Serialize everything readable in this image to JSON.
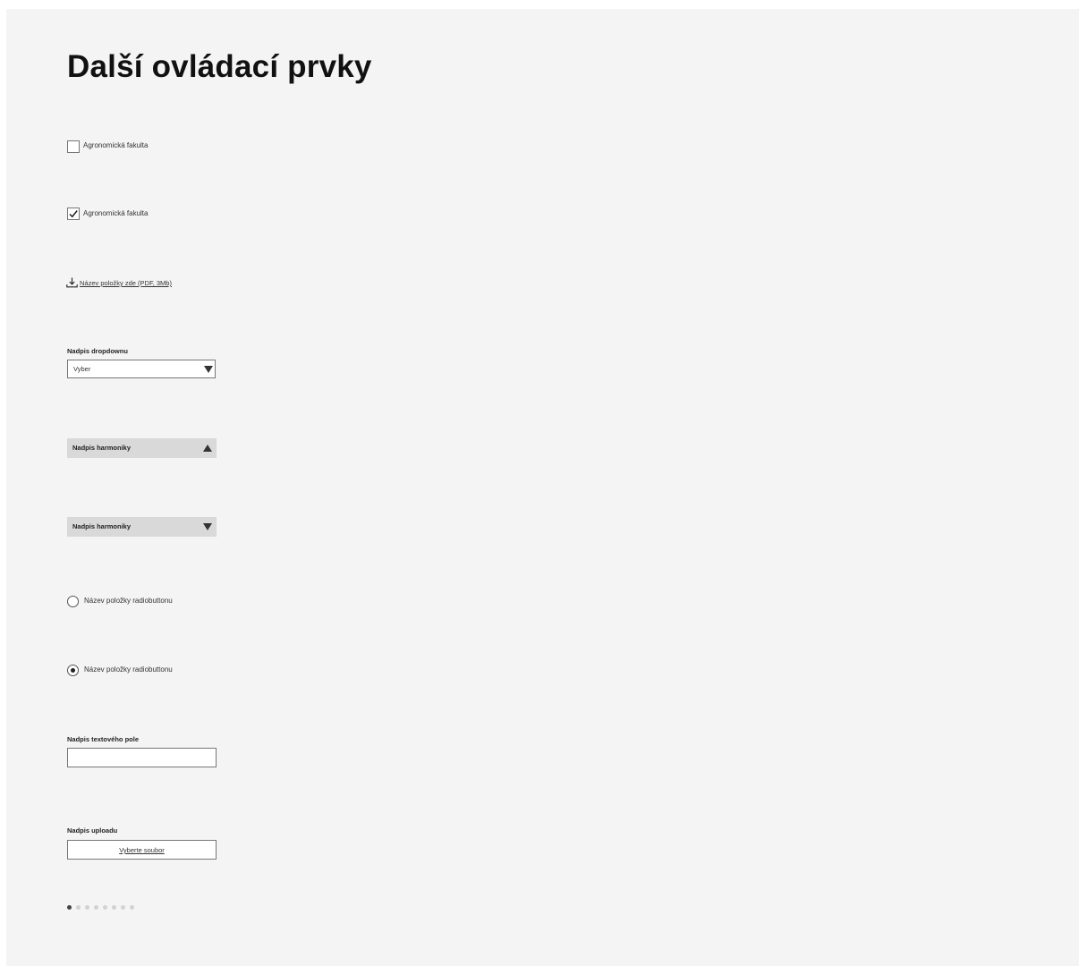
{
  "page": {
    "title": "Další ovládací prvky"
  },
  "checkboxes": [
    {
      "label": "Agronomická fakulta",
      "checked": false
    },
    {
      "label": "Agronomická fakulta",
      "checked": true
    }
  ],
  "download": {
    "icon": "download-icon",
    "label": "Název položky zde (PDF, 3Mb)"
  },
  "dropdown": {
    "label": "Nadpis dropdownu",
    "value": "Vyber",
    "icon": "triangle-down-icon"
  },
  "accordions": [
    {
      "label": "Nadpis harmoniky",
      "expanded": true,
      "icon": "triangle-up-icon"
    },
    {
      "label": "Nadpis harmoniky",
      "expanded": false,
      "icon": "triangle-down-icon"
    }
  ],
  "radios": [
    {
      "label": "Název položky radiobuttonu",
      "selected": false
    },
    {
      "label": "Název položky radiobuttonu",
      "selected": true
    }
  ],
  "text_field": {
    "label": "Nadpis textového pole",
    "value": ""
  },
  "upload": {
    "label": "Nadpis uploadu",
    "button_label": "Vyberte soubor"
  },
  "pagination": {
    "total": 8,
    "active": 1
  },
  "colors": {
    "panel_bg": "#f4f4f4",
    "accordion_bg": "#d9d9d9",
    "pager_active": "#444444",
    "pager_inactive": "#d2d2d2"
  }
}
